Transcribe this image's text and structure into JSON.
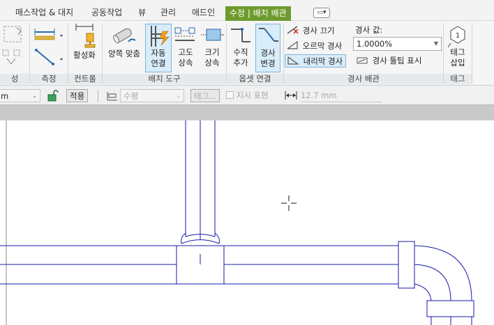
{
  "tabs": [
    {
      "label": "매스작업 & 대지"
    },
    {
      "label": "공동작업"
    },
    {
      "label": "뷰"
    },
    {
      "label": "관리"
    },
    {
      "label": "애드인"
    },
    {
      "label": "수정 | 배치 배관"
    },
    {
      "label": "▭▾"
    }
  ],
  "ribbon": {
    "left_panel": {
      "label": "성"
    },
    "measure": {
      "label": "측정"
    },
    "control": {
      "activate": "활성화",
      "label": "컨트롤"
    },
    "placement": {
      "label": "배치 도구",
      "both_fit": "양쪽 맞춤",
      "auto_connect": [
        "자동",
        "연결"
      ],
      "inherit_elev": [
        "고도",
        "상속"
      ],
      "inherit_size": [
        "크기",
        "상속"
      ]
    },
    "offset": {
      "label": "옵셋 연결",
      "vertical_add": [
        "수직",
        "추가"
      ],
      "slope_change": [
        "경사",
        "변경"
      ]
    },
    "slope": {
      "label": "경사 배관",
      "slope_off": "경사 끄기",
      "slope_up": "오르막 경사",
      "slope_down": "내리막 경사",
      "value_label": "경사 값:",
      "value": "1.0000%",
      "tooltip": "경사 툴팁 표시"
    },
    "tag": {
      "button": [
        "태그",
        "삽입"
      ],
      "label": "태그"
    }
  },
  "options": {
    "units": "m",
    "apply": "적용",
    "justification": "수평",
    "tag_button": "태그...",
    "guide_label": "지시 표현",
    "length": "12.7 mm"
  },
  "colors": {
    "accent_tab": "#6d9b2d",
    "pipe_line": "#1a1aa8"
  }
}
